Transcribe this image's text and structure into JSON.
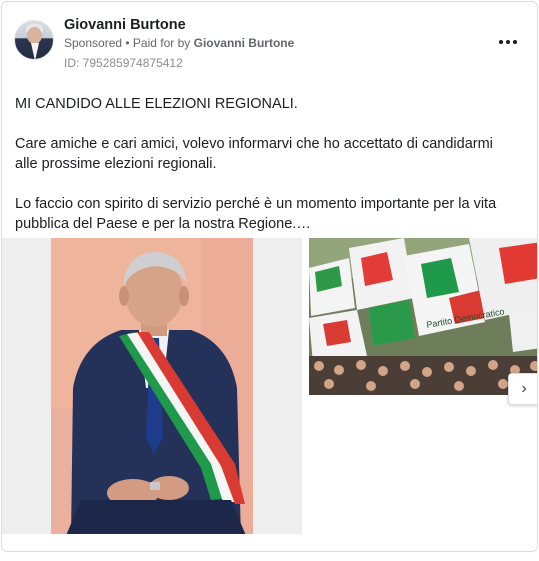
{
  "ad": {
    "author": "Giovanni Burtone",
    "sponsored_label": "Sponsored",
    "paid_for_prefix": " • Paid for by ",
    "paid_for_name": "Giovanni Burtone",
    "library_id": "ID: 795285974875412",
    "more_icon": "more-horizontal-icon",
    "paragraphs": [
      "MI CANDIDO ALLE ELEZIONI REGIONALI.",
      "Care amiche e cari amici, volevo informarvi che ho accettato di candidarmi alle prossime elezioni regionali.",
      "Lo faccio con spirito di servizio perché è un momento importante per la vita pubblica del Paese e per la nostra Regione.…"
    ]
  },
  "carousel": {
    "banner_text": "Partito Democratico",
    "next_glyph": "›",
    "next_icon": "chevron-right-icon"
  }
}
